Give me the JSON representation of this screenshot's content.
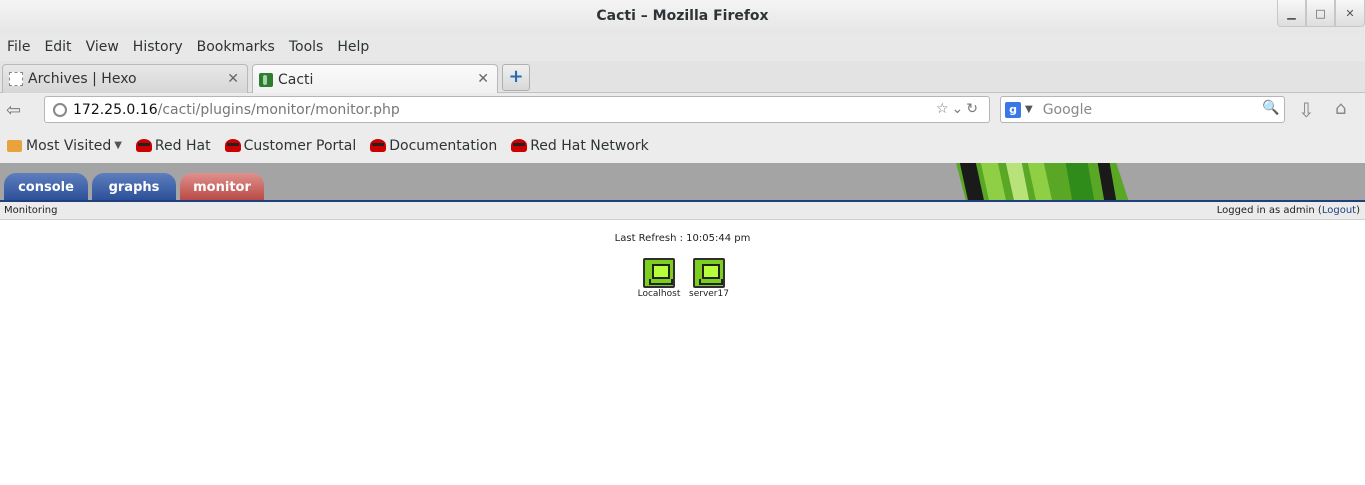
{
  "window": {
    "title": "Cacti – Mozilla Firefox",
    "controls": [
      "minimize",
      "maximize",
      "close"
    ]
  },
  "menu": [
    "File",
    "Edit",
    "View",
    "History",
    "Bookmarks",
    "Tools",
    "Help"
  ],
  "tabs": [
    {
      "label": "Archives | Hexo",
      "icon": "page-icon",
      "active": false
    },
    {
      "label": "Cacti",
      "icon": "cacti-icon",
      "active": true
    }
  ],
  "navbar": {
    "url_host": "172.25.0.16",
    "url_path": "/cacti/plugins/monitor/monitor.php",
    "search_placeholder": "Google"
  },
  "bookmarks": [
    {
      "label": "Most Visited",
      "icon": "folder-icon"
    },
    {
      "label": "Red Hat",
      "icon": "redhat-icon"
    },
    {
      "label": "Customer Portal",
      "icon": "redhat-icon"
    },
    {
      "label": "Documentation",
      "icon": "redhat-icon"
    },
    {
      "label": "Red Hat Network",
      "icon": "redhat-icon"
    }
  ],
  "cacti": {
    "tabs": [
      "console",
      "graphs",
      "monitor"
    ],
    "active_tab": "monitor",
    "section": "Monitoring",
    "logged_in_prefix": "Logged in as admin (",
    "logout_label": "Logout",
    "logged_in_suffix": ")",
    "last_refresh": "Last Refresh : 10:05:44 pm",
    "hosts": [
      {
        "name": "Localhost",
        "status": "up"
      },
      {
        "name": "server17",
        "status": "up"
      }
    ]
  },
  "colors": {
    "tab_blue": "#2b4e97",
    "tab_red": "#b84844",
    "header_gray": "#a4a4a4",
    "host_up": "#7ccf1e"
  }
}
